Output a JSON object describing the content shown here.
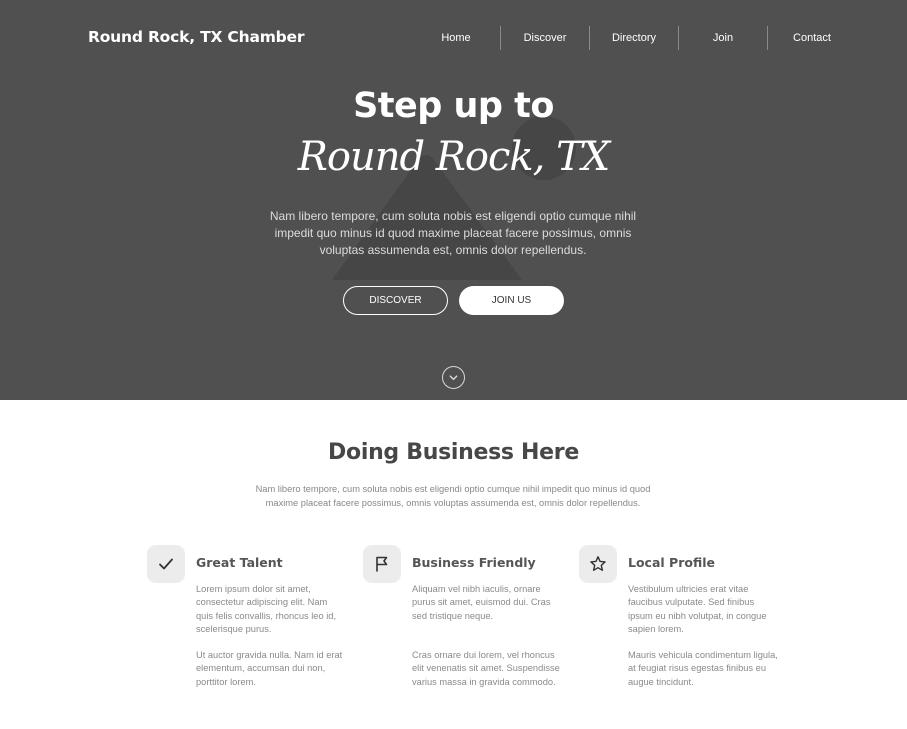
{
  "header": {
    "brand": "Round Rock, TX Chamber",
    "nav": [
      "Home",
      "Discover",
      "Directory",
      "Join",
      "Contact"
    ]
  },
  "hero": {
    "title": "Step up to",
    "script": "Round Rock, TX",
    "description": "Nam libero tempore, cum soluta nobis est eligendi optio cumque nihil impedit quo minus id quod maxime placeat facere possimus, omnis voluptas assumenda est, omnis dolor repellendus.",
    "buttons": {
      "discover": "DISCOVER",
      "join": "JOIN US"
    },
    "scroll_icon": "chevron-down-icon",
    "background_icon": "image-placeholder-icon"
  },
  "business": {
    "title": "Doing Business Here",
    "description": "Nam libero tempore, cum soluta nobis est eligendi optio cumque nihil impedit quo minus id quod maxime placeat facere possimus, omnis voluptas assumenda est, omnis dolor repellendus.",
    "features": [
      {
        "icon": "check-icon",
        "title": "Great Talent",
        "p1": "Lorem ipsum dolor sit amet, consectetur adipiscing elit. Nam quis felis convallis, rhoncus leo id, scelerisque purus.",
        "p2": "Ut auctor gravida nulla. Nam id erat elementum, accumsan dui non, porttitor lorem."
      },
      {
        "icon": "flag-icon",
        "title": "Business Friendly",
        "p1": "Aliquam vel nibh iaculis, ornare purus sit amet, euismod dui. Cras sed tristique neque.",
        "p2": "Cras ornare dui lorem, vel rhoncus elit venenatis sit amet. Suspendisse varius massa in gravida commodo."
      },
      {
        "icon": "star-icon",
        "title": "Local Profile",
        "p1": "Vestibulum ultricies erat vitae faucibus vulputate. Sed finibus ipsum eu nibh volutpat, in congue sapien lorem.",
        "p2": "Mauris vehicula condimentum ligula, at feugiat risus egestas finibus eu augue tincidunt."
      }
    ]
  },
  "colors": {
    "hero_bg": "#505050",
    "text_white": "#ffffff",
    "heading": "#474747",
    "body_text": "#8a8a8a",
    "icon_tile": "#ececec"
  }
}
